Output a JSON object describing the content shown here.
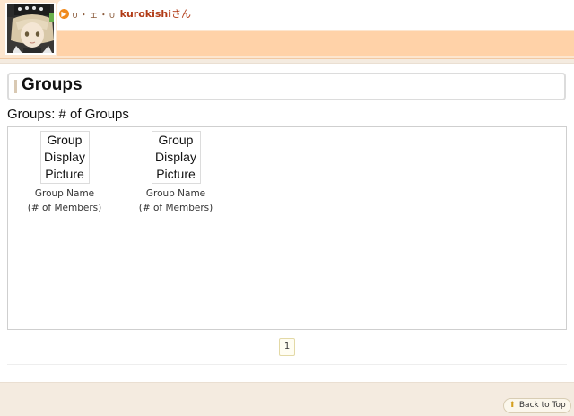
{
  "header": {
    "emoticon": "∪・ェ・∪",
    "username": "kurokishi",
    "honorific": "さん"
  },
  "page": {
    "title": "Groups",
    "count_label": "Groups: # of Groups"
  },
  "groups": [
    {
      "picture_line1": "Group",
      "picture_line2": "Display",
      "picture_line3": "Picture",
      "name": "Group Name",
      "members": "(# of Members)"
    },
    {
      "picture_line1": "Group",
      "picture_line2": "Display",
      "picture_line3": "Picture",
      "name": "Group Name",
      "members": "(# of Members)"
    }
  ],
  "pagination": {
    "current": "1"
  },
  "footer": {
    "back_to_top": "Back to Top"
  },
  "icons": {
    "greeting_arrow": "arrow-right-circle-icon",
    "back_to_top": "up-arrow-icon"
  }
}
